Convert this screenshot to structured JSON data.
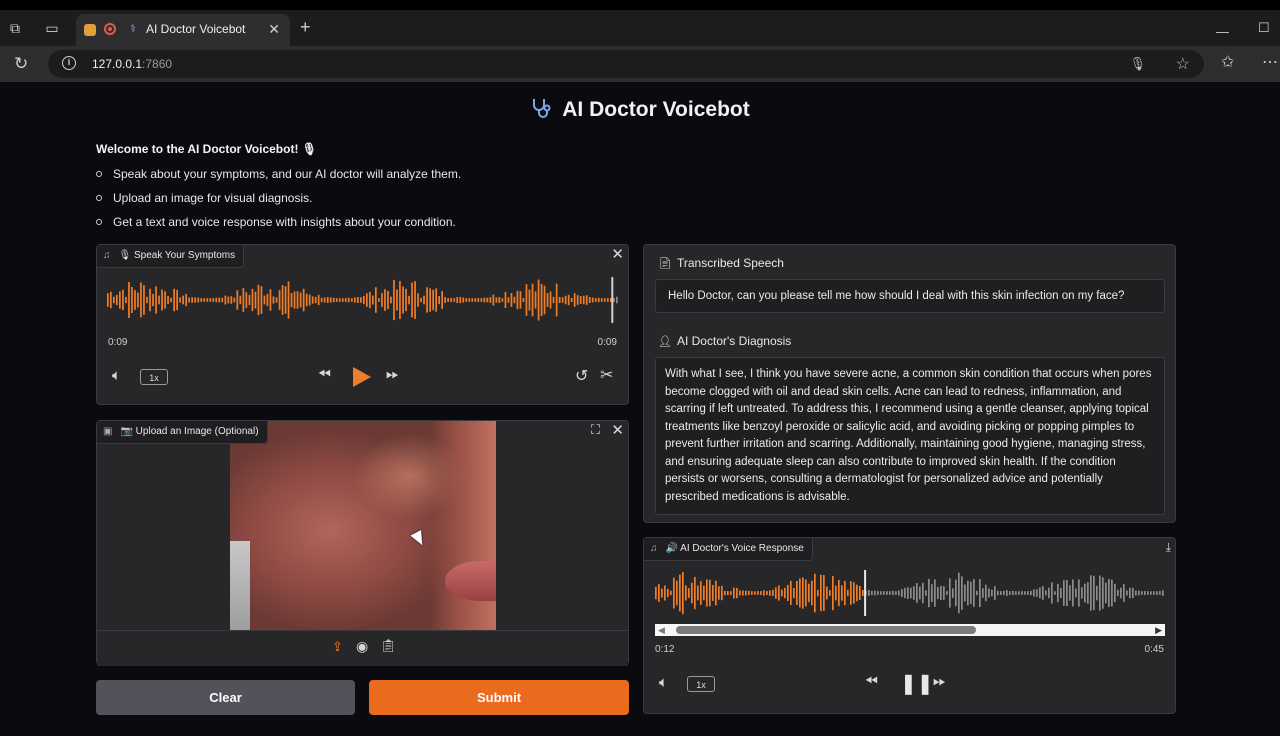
{
  "browser": {
    "tab_title": "AI Doctor Voicebot",
    "url_host": "127.0.0.1",
    "url_port": ":7860"
  },
  "app": {
    "title": "AI Doctor Voicebot",
    "welcome": "Welcome to the AI Doctor Voicebot! 🎙",
    "bullets": [
      "Speak about your symptoms, and our AI doctor will analyze them.",
      "Upload an image for visual diagnosis.",
      "Get a text and voice response with insights about your condition."
    ]
  },
  "audio_input": {
    "label": "🎙 Speak Your Symptoms",
    "time_current": "0:09",
    "time_total": "0:09",
    "playback_rate": "1x"
  },
  "image_input": {
    "label": "📷 Upload an Image (Optional)"
  },
  "buttons": {
    "clear": "Clear",
    "submit": "Submit"
  },
  "transcription": {
    "label": "Transcribed Speech",
    "text": "Hello Doctor, can you please tell me how should I deal with this skin infection on my face?"
  },
  "diagnosis": {
    "label": "AI Doctor's Diagnosis",
    "text": "With what I see, I think you have severe acne, a common skin condition that occurs when pores become clogged with oil and dead skin cells. Acne can lead to redness, inflammation, and scarring if left untreated. To address this, I recommend using a gentle cleanser, applying topical treatments like benzoyl peroxide or salicylic acid, and avoiding picking or popping pimples to prevent further irritation and scarring. Additionally, maintaining good hygiene, managing stress, and ensuring adequate sleep can also contribute to improved skin health. If the condition persists or worsens, consulting a dermatologist for personalized advice and potentially prescribed medications is advisable."
  },
  "voice_response": {
    "label": "🔊 AI Doctor's Voice Response",
    "time_current": "0:12",
    "time_total": "0:45",
    "playback_rate": "1x",
    "progress_fraction": 0.27
  },
  "colors": {
    "accent": "#f07d27",
    "waveform_unplayed": "#8c8c8c",
    "panel": "#27272a"
  }
}
